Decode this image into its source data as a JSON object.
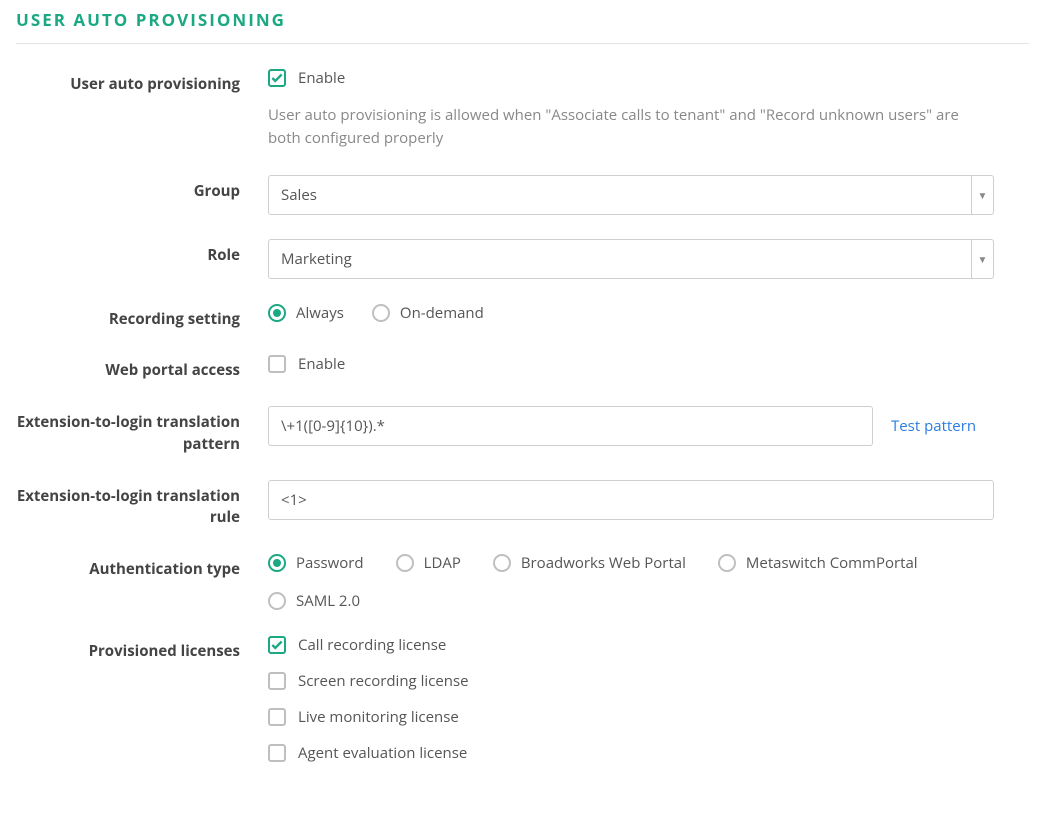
{
  "section_title": "USER AUTO PROVISIONING",
  "fields": {
    "user_auto_provisioning": {
      "label": "User auto provisioning",
      "checkbox_label": "Enable",
      "help": "User auto provisioning is allowed when \"Associate calls to tenant\" and \"Record unknown users\" are both configured properly"
    },
    "group": {
      "label": "Group",
      "value": "Sales"
    },
    "role": {
      "label": "Role",
      "value": "Marketing"
    },
    "recording_setting": {
      "label": "Recording setting",
      "options": {
        "always": "Always",
        "on_demand": "On-demand"
      }
    },
    "web_portal_access": {
      "label": "Web portal access",
      "checkbox_label": "Enable"
    },
    "ext_pattern": {
      "label": "Extension-to-login translation pattern",
      "value": "\\+1([0-9]{10}).*",
      "test_link": "Test pattern"
    },
    "ext_rule": {
      "label": "Extension-to-login translation rule",
      "value": "<1>"
    },
    "auth_type": {
      "label": "Authentication type",
      "options": {
        "password": "Password",
        "ldap": "LDAP",
        "broadworks": "Broadworks Web Portal",
        "metaswitch": "Metaswitch CommPortal",
        "saml": "SAML 2.0"
      }
    },
    "licenses": {
      "label": "Provisioned licenses",
      "items": {
        "call_rec": "Call recording license",
        "screen_rec": "Screen recording license",
        "live_mon": "Live monitoring license",
        "agent_eval": "Agent evaluation license"
      }
    }
  }
}
